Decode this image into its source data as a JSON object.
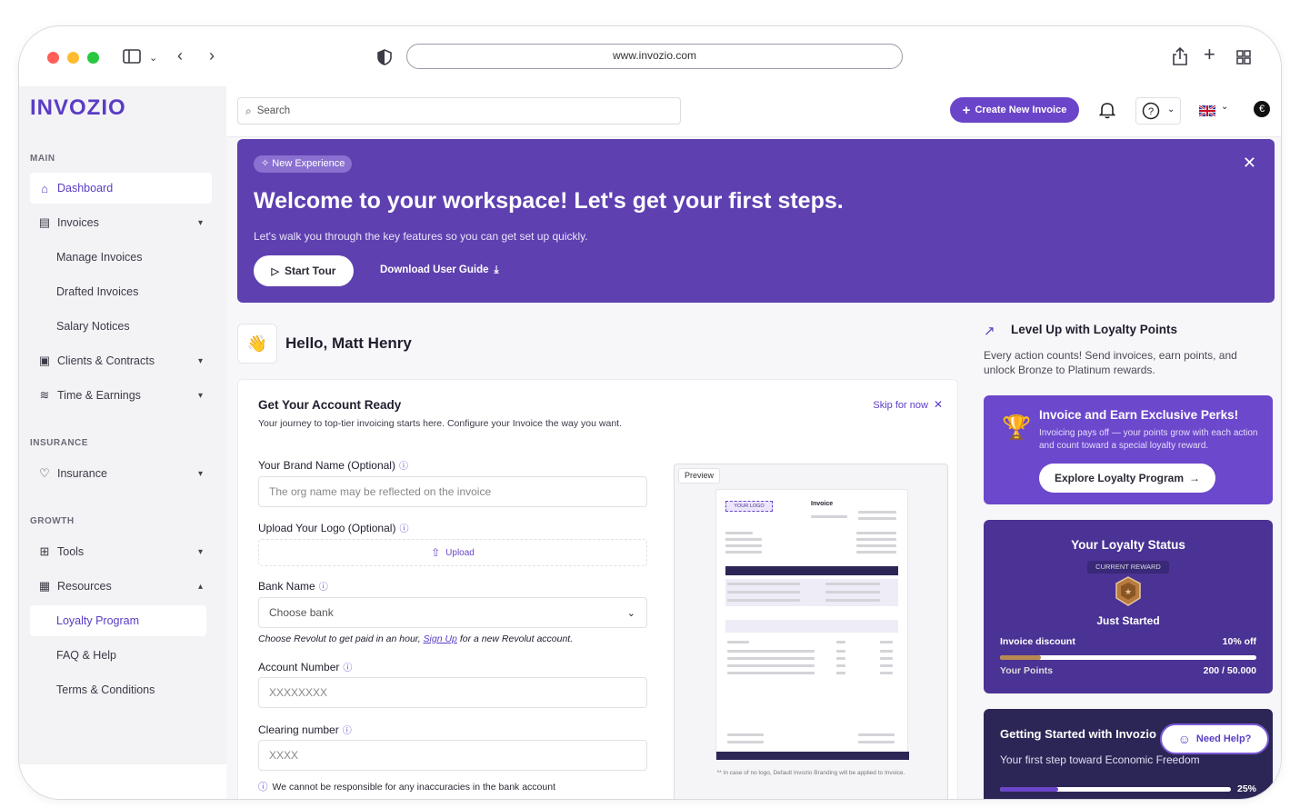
{
  "browser": {
    "url": "www.invozio.com"
  },
  "sidebar": {
    "logo": "INVOZIO",
    "sections": {
      "main": "MAIN",
      "insurance": "INSURANCE",
      "growth": "GROWTH"
    },
    "items": {
      "dashboard": "Dashboard",
      "invoices": "Invoices",
      "manage": "Manage Invoices",
      "drafted": "Drafted Invoices",
      "salary": "Salary Notices",
      "clients": "Clients & Contracts",
      "time": "Time & Earnings",
      "insurance": "Insurance",
      "tools": "Tools",
      "resources": "Resources",
      "loyalty": "Loyalty Program",
      "faq": "FAQ & Help",
      "terms": "Terms & Conditions"
    }
  },
  "topbar": {
    "search_placeholder": "Search",
    "create_label": "Create New Invoice"
  },
  "banner": {
    "pill": "New Experience",
    "title": "Welcome to your workspace! Let's get your first steps.",
    "subtitle": "Let's walk you through the key features so you can get set up quickly.",
    "tour": "Start Tour",
    "guide": "Download User Guide"
  },
  "greeting": {
    "text": "Hello, Matt Henry"
  },
  "setup": {
    "title": "Get Your Account Ready",
    "subtitle": "Your journey to top-tier invoicing starts here. Configure your Invoice the way you want.",
    "skip": "Skip for now",
    "brand_label": "Your Brand Name (Optional)",
    "brand_placeholder": "The org name may be reflected on the invoice",
    "logo_label": "Upload Your Logo (Optional)",
    "upload": "Upload",
    "bank_label": "Bank Name",
    "bank_placeholder": "Choose bank",
    "note_prefix": "Choose Revolut to get paid in an hour,",
    "note_link": "Sign Up",
    "note_suffix": "for a new Revolut account.",
    "account_label": "Account Number",
    "account_placeholder": "XXXXXXXX",
    "clearing_label": "Clearing number",
    "clearing_placeholder": "XXXX",
    "warning": "We cannot be responsible for any inaccuracies in the bank account"
  },
  "preview": {
    "tag": "Preview",
    "logo": "YOUR LOGO",
    "heading": "Invoice",
    "note": "** In case of no logo, Default Invozio Branding will be applied to Invoice."
  },
  "loyalty": {
    "title": "Level Up with Loyalty Points",
    "subtitle": "Every action counts! Send invoices, earn points, and unlock Bronze to Platinum rewards.",
    "perks_title": "Invoice and Earn Exclusive Perks!",
    "perks_text": "Invoicing pays off — your points grow with each action and count toward a special loyalty reward.",
    "perks_btn": "Explore Loyalty Program",
    "status_title": "Your Loyalty Status",
    "current": "CURRENT REWARD",
    "level": "Just Started",
    "discount_label": "Invoice discount",
    "discount_value": "10% off",
    "points_label": "Your Points",
    "points_value": "200 / 50.000",
    "points_progress": 0.004,
    "started_title": "Getting Started with Invozio",
    "started_sub": "Your first step toward Economic Freedom",
    "started_progress": 0.25,
    "started_pct": "25%"
  },
  "help": {
    "label": "Need Help?"
  },
  "colors": {
    "accent": "#5b3cc4",
    "banner": "#5e40b0"
  }
}
